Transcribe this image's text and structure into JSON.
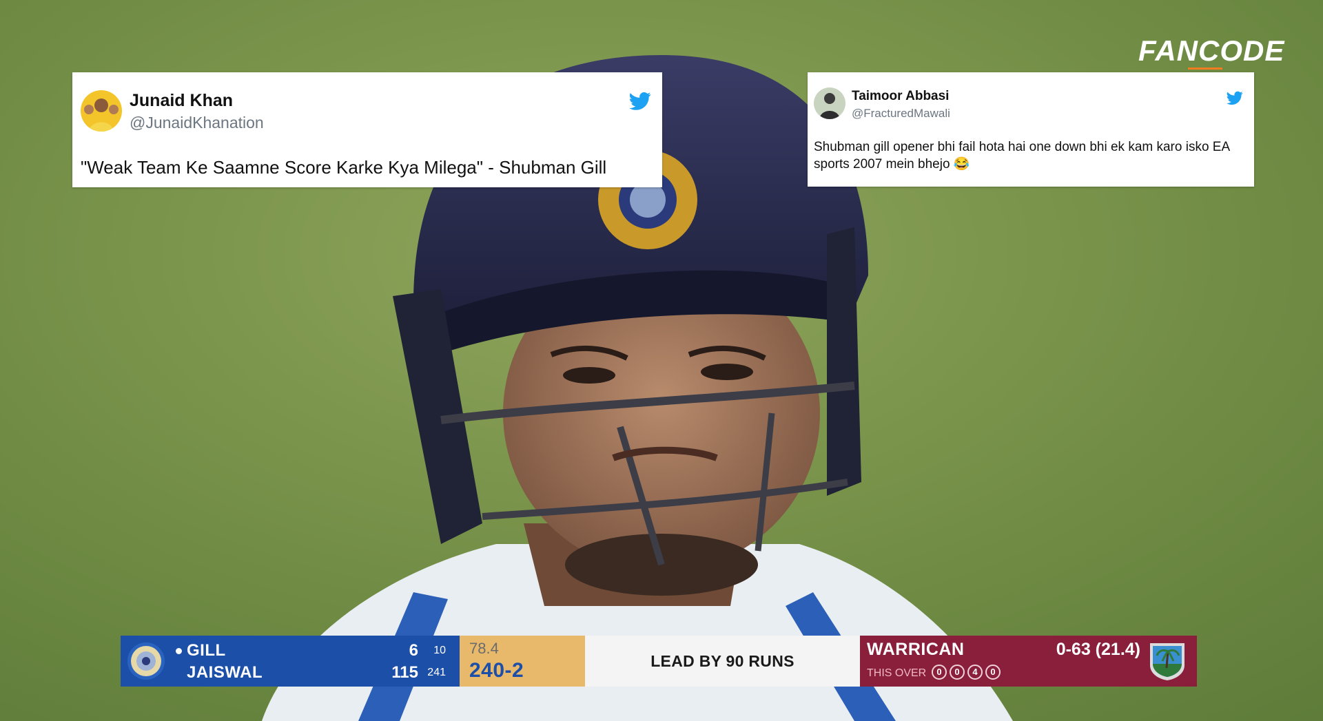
{
  "broadcast": {
    "logo_text": "FANCODE"
  },
  "tweets": [
    {
      "name": "Junaid Khan",
      "handle": "@JunaidKhanation",
      "text": "\"Weak Team Ke Saamne Score Karke Kya Milega\" - Shubman Gill",
      "icon": "twitter-bird"
    },
    {
      "name": "Taimoor Abbasi",
      "handle": "@FracturedMawali",
      "text": "Shubman gill opener bhi fail hota hai one down bhi ek kam karo isko EA sports 2007 mein bhejo 😂",
      "icon": "twitter-bird"
    }
  ],
  "scorebar": {
    "batting": {
      "batters": [
        {
          "name": "GILL",
          "runs": "6",
          "balls": "10",
          "on_strike": true
        },
        {
          "name": "JAISWAL",
          "runs": "115",
          "balls": "241",
          "on_strike": false
        }
      ]
    },
    "overs": "78.4",
    "total": "240-2",
    "message": "LEAD BY 90 RUNS",
    "bowling": {
      "bowler": "WARRICAN",
      "figures": "0-63 (21.4)",
      "this_over_label": "THIS OVER",
      "this_over_balls": [
        "0",
        "0",
        "4",
        "0"
      ]
    }
  },
  "colors": {
    "twitter_blue": "#1da1f2",
    "batting_blue": "#1c4fa8",
    "score_gold": "#e8b86b",
    "bowling_maroon": "#8a1f3c",
    "logo_accent": "#f47c20"
  }
}
